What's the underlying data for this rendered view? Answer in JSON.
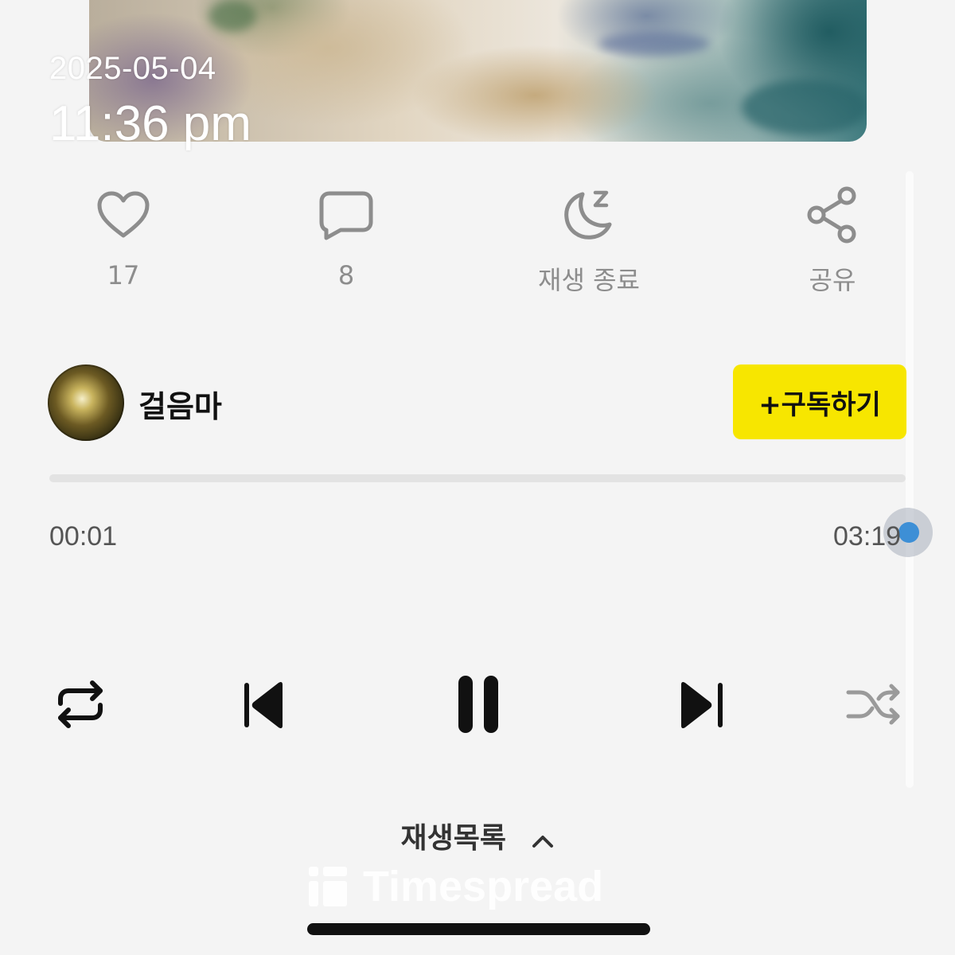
{
  "overlay": {
    "date": "2025-05-04",
    "time": "11:36 pm"
  },
  "actions": [
    {
      "icon": "heart-icon",
      "label": "17"
    },
    {
      "icon": "comment-icon",
      "label": "8"
    },
    {
      "icon": "sleep-timer-icon",
      "label": "재생 종료"
    },
    {
      "icon": "share-icon",
      "label": "공유"
    }
  ],
  "channel": {
    "name": "걸음마",
    "subscribe_label": "+구독하기"
  },
  "player": {
    "current_time": "00:01",
    "total_time": "03:19",
    "progress_fraction": 1.0,
    "controls": [
      "repeat-icon",
      "previous-icon",
      "pause-icon",
      "next-icon",
      "shuffle-icon"
    ]
  },
  "playlist": {
    "label": "재생목록",
    "icon": "chevron-up-icon"
  },
  "watermark": {
    "text": "Timespread"
  },
  "colors": {
    "accent": "#f7e600",
    "progress_knob": "#3d8fd6",
    "background": "#f4f4f4"
  }
}
